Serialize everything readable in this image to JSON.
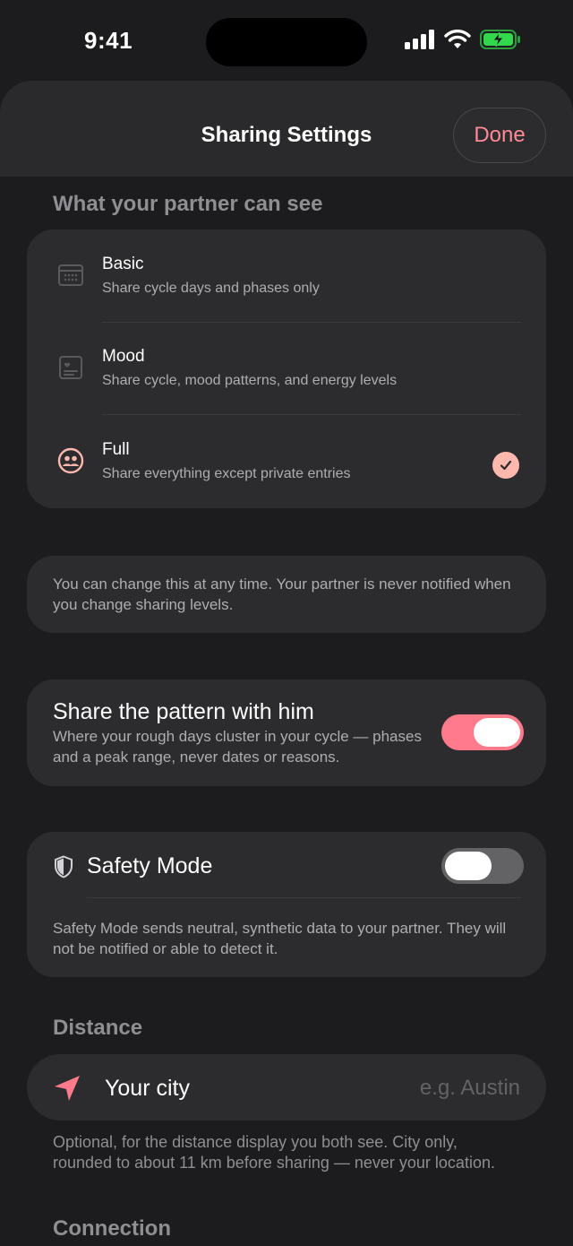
{
  "status": {
    "time": "9:41"
  },
  "header": {
    "title": "Sharing Settings",
    "done_label": "Done"
  },
  "visibility": {
    "section_label": "What your partner can see",
    "options": [
      {
        "title": "Basic",
        "subtitle": "Share cycle days and phases only",
        "icon": "calendar-icon",
        "selected": false
      },
      {
        "title": "Mood",
        "subtitle": "Share cycle, mood patterns, and energy levels",
        "icon": "heart-note-icon",
        "selected": false
      },
      {
        "title": "Full",
        "subtitle": "Share everything except private entries",
        "icon": "people-icon",
        "selected": true
      }
    ],
    "info": "You can change this at any time. Your partner is never notified when you change sharing levels."
  },
  "pattern": {
    "title": "Share the pattern with him",
    "subtitle": "Where your rough days cluster in your cycle — phases and a peak range, never dates or reasons.",
    "enabled": true
  },
  "safety": {
    "title": "Safety Mode",
    "description": "Safety Mode sends neutral, synthetic data to your partner. They will not be notified or able to detect it.",
    "enabled": false
  },
  "distance": {
    "section_label": "Distance",
    "city_label": "Your city",
    "city_value": "",
    "city_placeholder": "e.g. Austin",
    "note": "Optional, for the distance display you both see. City only, rounded to about 11 km before sharing — never your location."
  },
  "connection": {
    "section_label": "Connection"
  },
  "colors": {
    "accent": "#ff8a95",
    "toggle_on": "#ff7a8a",
    "toggle_off": "#636366",
    "check_fill": "#ffb8ae"
  }
}
